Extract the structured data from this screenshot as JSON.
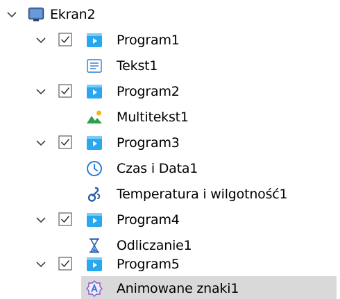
{
  "tree": {
    "root": {
      "label": "Ekran2",
      "icon": "monitor-icon",
      "expanded": true
    },
    "programs": [
      {
        "label": "Program1",
        "checked": true,
        "expanded": true,
        "icon": "program-icon",
        "children": [
          {
            "label": "Tekst1",
            "icon": "text-icon"
          }
        ]
      },
      {
        "label": "Program2",
        "checked": true,
        "expanded": true,
        "icon": "program-icon",
        "children": [
          {
            "label": "Multitekst1",
            "icon": "image-icon"
          }
        ]
      },
      {
        "label": "Program3",
        "checked": true,
        "expanded": true,
        "icon": "program-icon",
        "children": [
          {
            "label": "Czas i Data1",
            "icon": "clock-icon"
          },
          {
            "label": "Temperatura i wilgotność1",
            "icon": "thermometer-icon"
          }
        ]
      },
      {
        "label": "Program4",
        "checked": true,
        "expanded": true,
        "icon": "program-icon",
        "children": [
          {
            "label": "Odliczanie1",
            "icon": "hourglass-icon"
          }
        ]
      },
      {
        "label": "Program5",
        "checked": true,
        "expanded": true,
        "icon": "program-icon",
        "children": [
          {
            "label": "Animowane znaki1",
            "icon": "animated-text-icon",
            "selected": true
          }
        ]
      }
    ]
  },
  "colors": {
    "selection": "#d9d9d9",
    "accent": "#1e88e5",
    "checkbox_border": "#6b6b6b",
    "chevron": "#404040"
  }
}
